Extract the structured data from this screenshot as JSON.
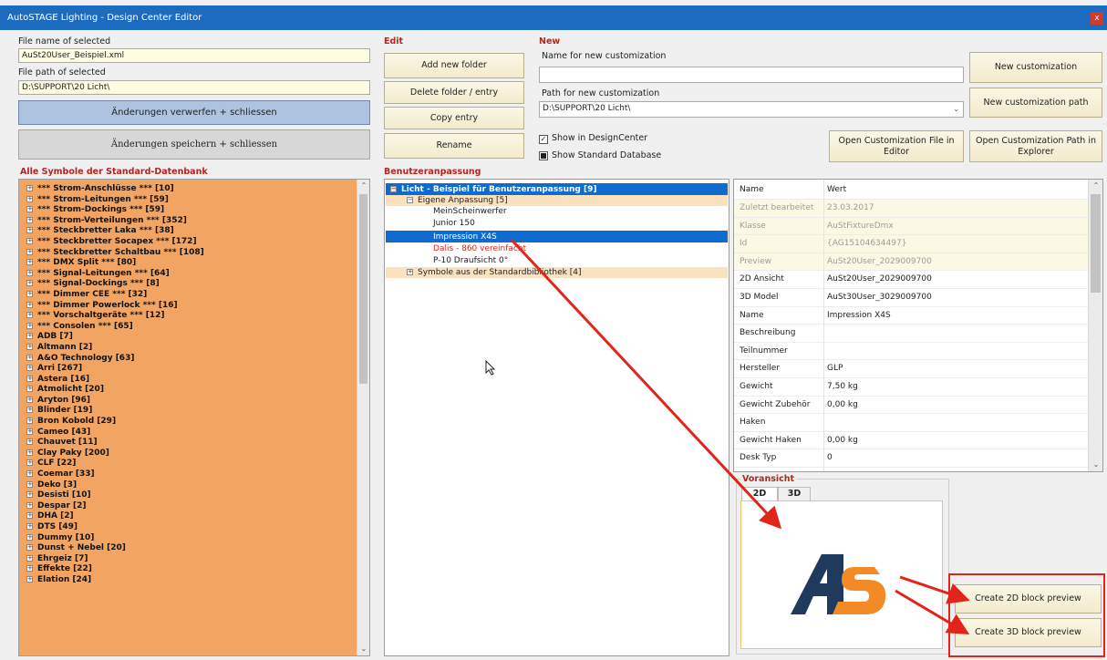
{
  "window": {
    "title": "AutoSTAGE Lighting - Design Center Editor",
    "close": "x"
  },
  "file": {
    "name_label": "File name of selected",
    "name_value": "AuSt20User_Beispiel.xml",
    "path_label": "File path of selected",
    "path_value": "D:\\SUPPORT\\20 Licht\\",
    "discard_label": "Änderungen verwerfen + schliessen",
    "save_label": "Änderungen speichern + schliessen"
  },
  "edit": {
    "title": "Edit",
    "add_folder": "Add new folder",
    "delete_entry": "Delete folder / entry",
    "copy_entry": "Copy entry",
    "rename": "Rename"
  },
  "new": {
    "title": "New",
    "name_label": "Name for new customization",
    "name_value": "",
    "path_label": "Path for new customization",
    "path_value": "D:\\SUPPORT\\20 Licht\\",
    "new_customization": "New customization",
    "new_customization_path": "New customization path",
    "show_designcenter": "Show in DesignCenter",
    "show_standard_db": "Show Standard Database",
    "open_file_in_editor": "Open Customization File in Editor",
    "open_path_in_explorer": "Open Customization Path in Explorer"
  },
  "symbols": {
    "title": "Alle Symbole der Standard-Datenbank",
    "items": [
      "*** Strom-Anschlüsse ***  [10]",
      "*** Strom-Leitungen ***  [59]",
      "*** Strom-Dockings ***  [59]",
      "*** Strom-Verteilungen ***  [352]",
      "*** Steckbretter Laka ***  [38]",
      "*** Steckbretter Socapex ***  [172]",
      "*** Steckbretter Schaltbau ***  [108]",
      "*** DMX Split ***  [80]",
      "*** Signal-Leitungen ***  [64]",
      "*** Signal-Dockings ***  [8]",
      "*** Dimmer CEE ***  [32]",
      "*** Dimmer Powerlock ***  [16]",
      "*** Vorschaltgeräte ***  [12]",
      "*** Consolen ***  [65]",
      "ADB  [7]",
      "Altmann  [2]",
      "A&O Technology  [63]",
      "Arri  [267]",
      "Astera  [16]",
      "Atmolicht  [20]",
      "Aryton  [96]",
      "Blinder  [19]",
      "Bron Kobold  [29]",
      "Cameo  [43]",
      "Chauvet  [11]",
      "Clay Paky  [200]",
      "CLF  [22]",
      "Coemar  [33]",
      "Deko  [3]",
      "Desisti  [10]",
      "Despar  [2]",
      "DHA  [2]",
      "DTS  [49]",
      "Dummy  [10]",
      "Dunst + Nebel  [20]",
      "Ehrgeiz  [7]",
      "Effekte  [22]",
      "Elation  [24]"
    ]
  },
  "customization": {
    "title": "Benutzeranpassung",
    "root": "Licht - Beispiel für Benutzeranpassung  [9]",
    "own": "Eigene Anpassung  [5]",
    "children": [
      "MeinScheinwerfer",
      "Junior 150",
      "Impression X4S",
      "Dalis - 860 vereinfacht",
      "P-10 Draufsicht 0°"
    ],
    "std": "Symbole aus der Standardbibliothek  [4]"
  },
  "properties": {
    "header_key": "Name",
    "header_value": "Wert",
    "rows": [
      {
        "k": "Zuletzt bearbeitet",
        "v": "23.03.2017"
      },
      {
        "k": "Klasse",
        "v": "AuStFixtureDmx"
      },
      {
        "k": "Id",
        "v": "{AG15104634497}"
      },
      {
        "k": "Preview",
        "v": "AuSt20User_2029009700"
      },
      {
        "k": "2D Ansicht",
        "v": "AuSt20User_2029009700"
      },
      {
        "k": "3D Model",
        "v": "AuSt30User_3029009700"
      },
      {
        "k": "Name",
        "v": "Impression X4S"
      },
      {
        "k": "Beschreibung",
        "v": ""
      },
      {
        "k": "Teilnummer",
        "v": ""
      },
      {
        "k": "Hersteller",
        "v": "GLP"
      },
      {
        "k": "Gewicht",
        "v": "7,50 kg"
      },
      {
        "k": "Gewicht Zubehör",
        "v": "0,00 kg"
      },
      {
        "k": "Haken",
        "v": ""
      },
      {
        "k": "Gewicht Haken",
        "v": "0,00 kg"
      },
      {
        "k": "Desk Typ",
        "v": "0"
      }
    ]
  },
  "preview": {
    "title": "Voransicht",
    "tab_2d": "2D",
    "tab_3d": "3D",
    "logo_text": "AS",
    "create_2d": "Create 2D block preview",
    "create_3d": "Create 3D block preview"
  },
  "colors": {
    "titlebar": "#1c6bc0",
    "list_orange": "#f2a462",
    "section_red": "#b3261e",
    "selection_blue": "#0f6bd0",
    "logo_navy": "#1f3a5c",
    "logo_orange": "#f28a26",
    "annotation_red": "#e3241b"
  }
}
